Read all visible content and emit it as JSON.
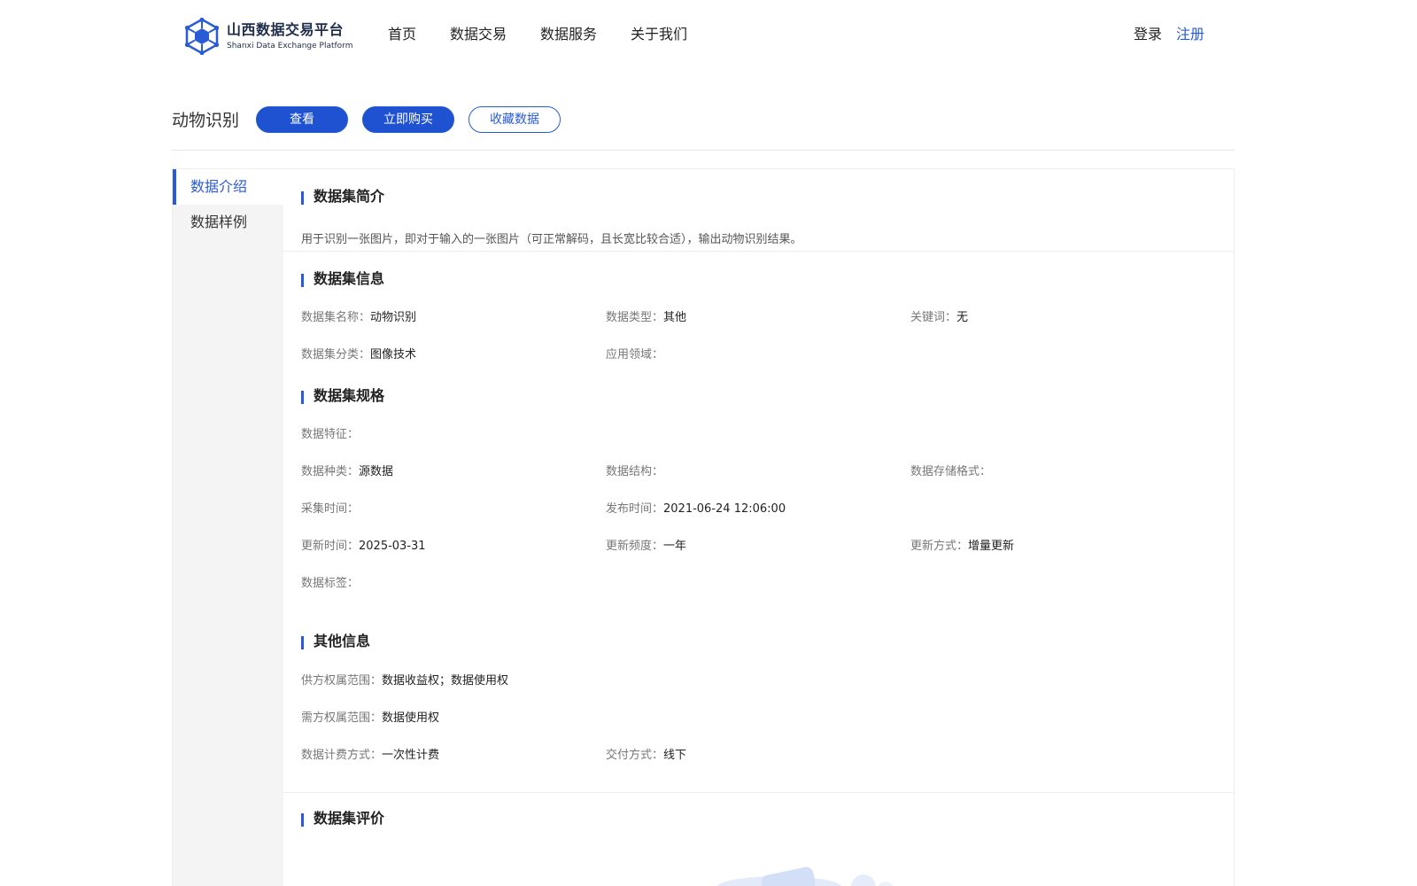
{
  "header": {
    "logo_cn": "山西数据交易平台",
    "logo_en": "Shanxi Data Exchange Platform",
    "nav": [
      "首页",
      "数据交易",
      "数据服务",
      "关于我们"
    ],
    "login": "登录",
    "register": "注册"
  },
  "title_bar": {
    "title": "动物识别",
    "view_button": "查看",
    "buy_button": "立即购买",
    "favorite_button": "收藏数据"
  },
  "sidebar": {
    "items": [
      "数据介绍",
      "数据样例"
    ],
    "active": "数据介绍"
  },
  "intro": {
    "title": "数据集简介",
    "text": "用于识别一张图片，即对于输入的一张图片（可正常解码，且长宽比较合适），输出动物识别结果。"
  },
  "info": {
    "title": "数据集信息",
    "name_label": "数据集名称：",
    "name_value": "动物识别",
    "type_label": "数据类型：",
    "type_value": "其他",
    "keyword_label": "关键词：",
    "keyword_value": "无",
    "category_label": "数据集分类：",
    "category_value": "图像技术",
    "domain_label": "应用领域：",
    "domain_value": ""
  },
  "spec": {
    "title": "数据集规格",
    "feature_label": "数据特征：",
    "feature_value": "",
    "kind_label": "数据种类：",
    "kind_value": "源数据",
    "structure_label": "数据结构：",
    "structure_value": "",
    "storage_label": "数据存储格式：",
    "storage_value": "",
    "collect_label": "采集时间：",
    "collect_value": "",
    "publish_label": "发布时间：",
    "publish_value": "2021-06-24 12:06:00",
    "update_time_label": "更新时间：",
    "update_time_value": "2025-03-31",
    "update_freq_label": "更新频度：",
    "update_freq_value": "一年",
    "update_mode_label": "更新方式：",
    "update_mode_value": "增量更新",
    "tag_label": "数据标签：",
    "tag_value": ""
  },
  "other": {
    "title": "其他信息",
    "supplier_label": "供方权属范围：",
    "supplier_value": "数据收益权；数据使用权",
    "demand_label": "需方权属范围：",
    "demand_value": "数据使用权",
    "billing_label": "数据计费方式：",
    "billing_value": "一次性计费",
    "delivery_label": "交付方式：",
    "delivery_value": "线下"
  },
  "evaluation": {
    "title": "数据集评价"
  },
  "colors": {
    "accent": "#2a5bd7",
    "sidebar_bg": "#f4f4f4",
    "label_gray": "#777777"
  }
}
